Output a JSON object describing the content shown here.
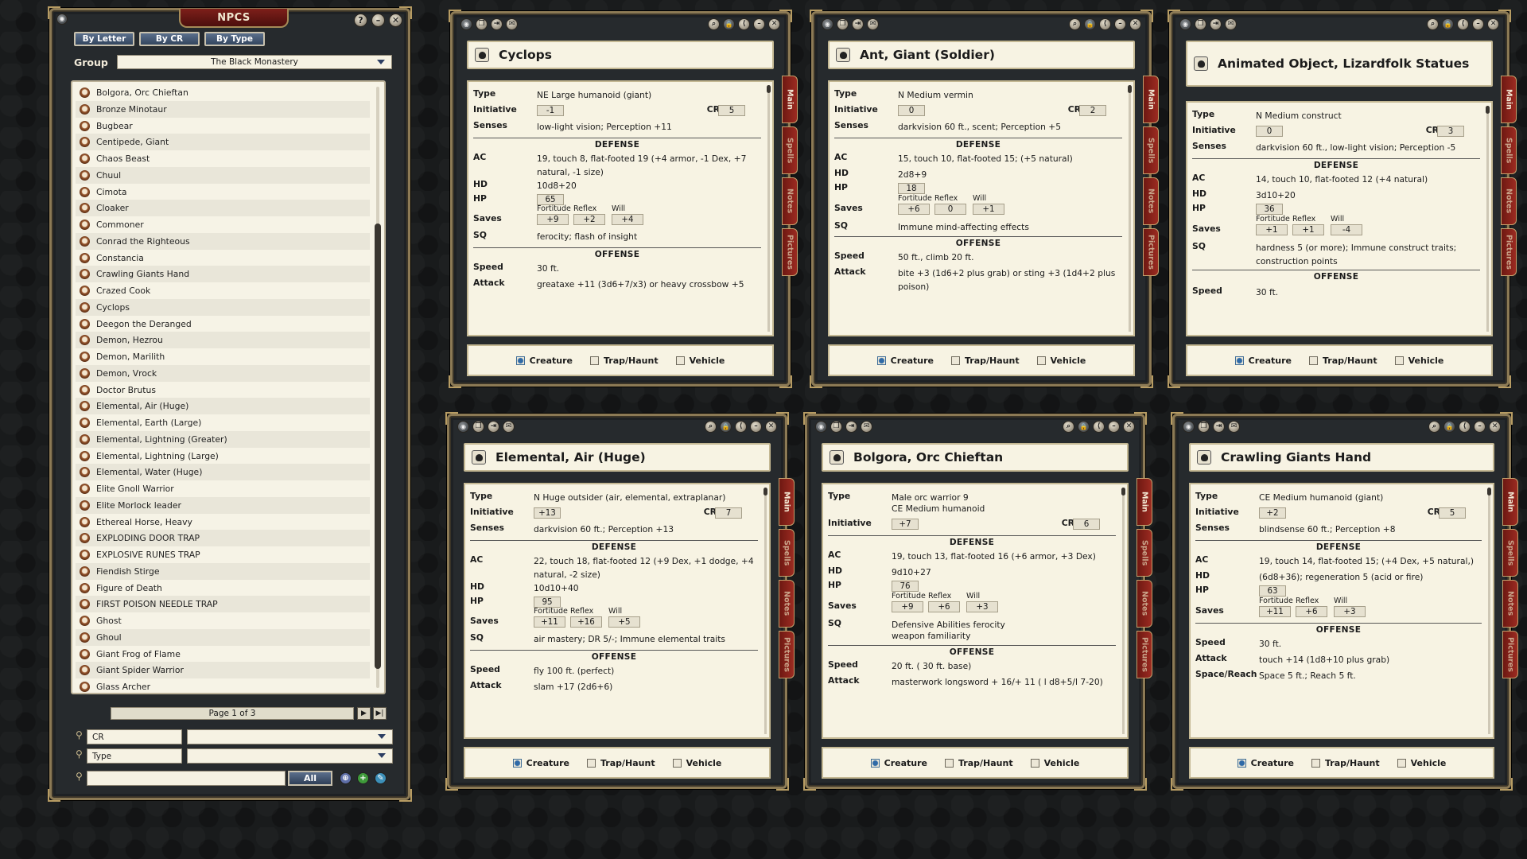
{
  "npc_list": {
    "title": "NPCS",
    "tabs": [
      "By Letter",
      "By CR",
      "By Type"
    ],
    "group_label": "Group",
    "group_value": "The Black Monastery",
    "items": [
      "Bolgora, Orc Chieftan",
      "Bronze Minotaur",
      "Bugbear",
      "Centipede, Giant",
      "Chaos Beast",
      "Chuul",
      "Cimota",
      "Cloaker",
      "Commoner",
      "Conrad the Righteous",
      "Constancia",
      "Crawling Giants Hand",
      "Crazed Cook",
      "Cyclops",
      "Deegon the Deranged",
      "Demon, Hezrou",
      "Demon, Marilith",
      "Demon, Vrock",
      "Doctor Brutus",
      "Elemental, Air (Huge)",
      "Elemental, Earth (Large)",
      "Elemental, Lightning (Greater)",
      "Elemental, Lightning (Large)",
      "Elemental, Water (Huge)",
      "Elite Gnoll Warrior",
      "Elite Morlock leader",
      "Ethereal Horse, Heavy",
      "EXPLODING DOOR TRAP",
      "EXPLOSIVE RUNES TRAP",
      "Fiendish Stirge",
      "Figure of Death",
      "FIRST POISON NEEDLE TRAP",
      "Ghost",
      "Ghoul",
      "Giant Frog of Flame",
      "Giant Spider Warrior",
      "Glass Archer"
    ],
    "page_label": "Page 1 of 3",
    "filters": [
      {
        "label": "CR",
        "value": ""
      },
      {
        "label": "Type",
        "value": ""
      }
    ],
    "search_value": "",
    "all_label": "All"
  },
  "sheet_common": {
    "labels": {
      "type": "Type",
      "initiative": "Initiative",
      "cr": "CR",
      "senses": "Senses",
      "ac": "AC",
      "hd": "HD",
      "hp": "HP",
      "saves": "Saves",
      "sq": "SQ",
      "speed": "Speed",
      "attack": "Attack",
      "space_reach": "Space/Reach",
      "fort": "Fortitude",
      "ref": "Reflex",
      "will": "Will"
    },
    "headers": {
      "defense": "DEFENSE",
      "offense": "OFFENSE"
    },
    "footer": [
      "Creature",
      "Trap/Haunt",
      "Vehicle"
    ],
    "side_tabs": [
      "Main",
      "Spells",
      "Notes",
      "Pictures"
    ]
  },
  "sheets": [
    {
      "name": "Cyclops",
      "type": "NE Large humanoid (giant)",
      "init": "-1",
      "cr": "5",
      "senses": "low-light vision; Perception +11",
      "ac": "19, touch 8, flat-footed 19 (+4 armor, -1 Dex, +7 natural, -1 size)",
      "hd": "10d8+20",
      "hp": "65",
      "fort": "+9",
      "ref": "+2",
      "will": "+4",
      "sq": "ferocity; flash of insight",
      "speed": "30 ft.",
      "attack": "greataxe +11 (3d6+7/x3) or heavy crossbow +5"
    },
    {
      "name": "Ant, Giant (Soldier)",
      "type": "N Medium vermin",
      "init": "0",
      "cr": "2",
      "senses": "darkvision 60 ft., scent; Perception +5",
      "ac": "15, touch 10, flat-footed 15; (+5 natural)",
      "hd": "2d8+9",
      "hp": "18",
      "fort": "+6",
      "ref": "0",
      "will": "+1",
      "sq": "Immune mind-affecting effects",
      "speed": "50 ft., climb 20 ft.",
      "attack": "bite +3 (1d6+2 plus grab) or sting +3 (1d4+2 plus poison)"
    },
    {
      "name": "Animated Object, Lizardfolk Statues",
      "type": "N Medium construct",
      "init": "0",
      "cr": "3",
      "senses": "darkvision 60 ft., low-light vision; Perception -5",
      "ac": "14, touch 10, flat-footed 12 (+4 natural)",
      "hd": "3d10+20",
      "hp": "36",
      "fort": "+1",
      "ref": "+1",
      "will": "-4",
      "sq": "hardness 5 (or more); Immune construct traits; construction points",
      "speed": "30 ft."
    },
    {
      "name": "Elemental, Air (Huge)",
      "type": "N Huge outsider (air, elemental, extraplanar)",
      "init": "+13",
      "cr": "7",
      "senses": "darkvision 60 ft.; Perception +13",
      "ac": "22, touch 18, flat-footed 12 (+9 Dex, +1 dodge, +4 natural, -2 size)",
      "hd": "10d10+40",
      "hp": "95",
      "fort": "+11",
      "ref": "+16",
      "will": "+5",
      "sq": "air mastery; DR 5/-; Immune elemental traits",
      "speed": "fly 100 ft. (perfect)",
      "attack": "slam +17 (2d6+6)"
    },
    {
      "name": "Bolgora, Orc Chieftan",
      "type": "Male orc warrior 9",
      "type2": "CE Medium humanoid",
      "init": "+7",
      "cr": "6",
      "ac": "19, touch 13, flat-footed 16 (+6 armor, +3 Dex)",
      "hd": "9d10+27",
      "hp": "76",
      "fort": "+9",
      "ref": "+6",
      "will": "+3",
      "sq": "Defensive Abilities ferocity",
      "sq2": "weapon familiarity",
      "speed": "20 ft. ( 30 ft. base)",
      "attack": "masterwork longsword + 16/+ 11 ( l d8+5/l 7-20)"
    },
    {
      "name": "Crawling Giants Hand",
      "type": "CE Medium humanoid (giant)",
      "init": "+2",
      "cr": "5",
      "senses": "blindsense 60 ft.; Perception +8",
      "ac": "19, touch 14, flat-footed 15; (+4 Dex, +5 natural,)",
      "hd": "(6d8+36); regeneration 5 (acid or fire)",
      "hp": "63",
      "fort": "+11",
      "ref": "+6",
      "will": "+3",
      "speed": "30 ft.",
      "attack": "touch +14 (1d8+10 plus grab)",
      "space": "Space 5 ft.; Reach 5 ft."
    }
  ]
}
